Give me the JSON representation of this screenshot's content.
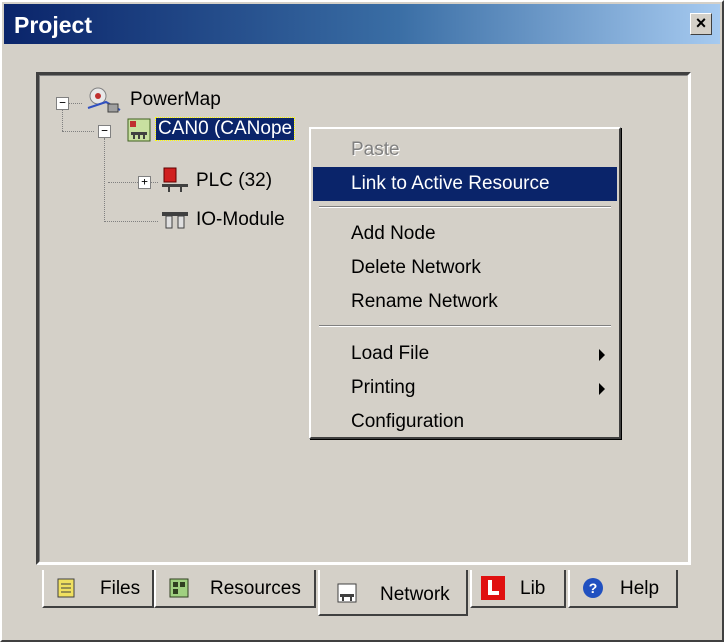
{
  "window": {
    "title": "Project",
    "close_glyph": "×"
  },
  "tree": {
    "root": {
      "label": "PowerMap",
      "icon": "powermap-icon",
      "expander": "−"
    },
    "network": {
      "label": "CAN0 (CANope",
      "icon": "can-network-icon",
      "expander": "−"
    },
    "plc": {
      "label": "PLC (32)",
      "icon": "plc-icon",
      "expander": "+"
    },
    "iomodule": {
      "label": "IO-Module",
      "icon": "io-module-icon"
    }
  },
  "context_menu": {
    "items": [
      {
        "label": "Paste",
        "state": "disabled"
      },
      {
        "label": "Link to Active Resource",
        "state": "highlighted"
      },
      {
        "label": "Add Node"
      },
      {
        "label": "Delete Network"
      },
      {
        "label": "Rename Network"
      },
      {
        "label": "Load File",
        "submenu": true
      },
      {
        "label": "Printing",
        "submenu": true
      },
      {
        "label": "Configuration"
      }
    ]
  },
  "tabs": [
    {
      "label": "Files",
      "icon": "files-icon"
    },
    {
      "label": "Resources",
      "icon": "resources-icon"
    },
    {
      "label": "Network",
      "icon": "network-icon",
      "active": true
    },
    {
      "label": "Lib",
      "icon": "lib-icon"
    },
    {
      "label": "Help",
      "icon": "help-icon"
    }
  ],
  "colors": {
    "selection": "#0a246a",
    "face": "#d4d0c8"
  }
}
